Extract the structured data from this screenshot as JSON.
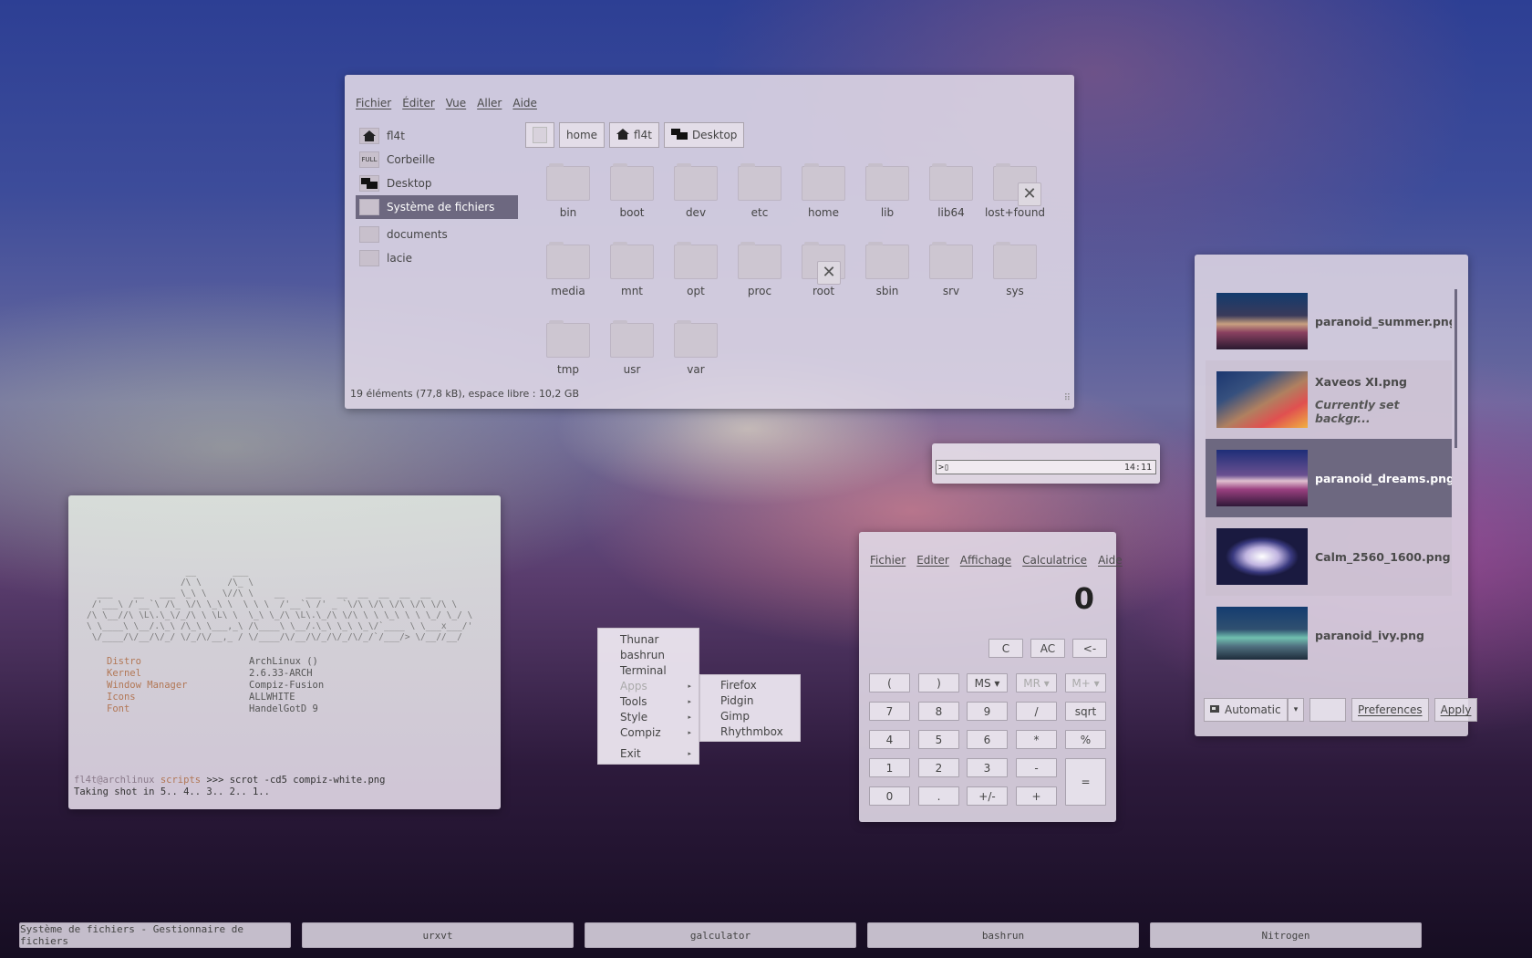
{
  "thunar": {
    "menu": [
      "Fichier",
      "Éditer",
      "Vue",
      "Aller",
      "Aide"
    ],
    "sidebar": [
      {
        "label": "fl4t",
        "icon": "home-icon"
      },
      {
        "label": "Corbeille",
        "icon": "trash-full-icon"
      },
      {
        "label": "Desktop",
        "icon": "desktop-icon"
      },
      {
        "label": "Système de fichiers",
        "icon": "drive-icon",
        "selected": true
      },
      {
        "label": "documents",
        "icon": "folder-icon"
      },
      {
        "label": "lacie",
        "icon": "folder-icon"
      }
    ],
    "trash_badge": "FULL",
    "path": [
      "home",
      "fl4t",
      "Desktop"
    ],
    "files": [
      "bin",
      "boot",
      "dev",
      "etc",
      "home",
      "lib",
      "lib64",
      "lost+found",
      "media",
      "mnt",
      "opt",
      "proc",
      "root",
      "sbin",
      "srv",
      "sys",
      "tmp",
      "usr",
      "var"
    ],
    "locked_glyph": "✕",
    "status": "19 éléments (77,8 kB), espace libre : 10,2 GB",
    "grip": "⠿"
  },
  "nitrogen": {
    "wallpapers": [
      {
        "name": "paranoid_summer.png",
        "sub": ""
      },
      {
        "name": "Xaveos XI.png",
        "sub": "Currently set backgr..."
      },
      {
        "name": "paranoid_dreams.png",
        "sub": "",
        "selected": true
      },
      {
        "name": "Calm_2560_1600.png",
        "sub": ""
      },
      {
        "name": "paranoid_ivy.png",
        "sub": ""
      }
    ],
    "mode": "Automatic",
    "preferences": "Preferences",
    "apply": "Apply",
    "dropdown_glyph": "▾"
  },
  "bashrun": {
    "prompt": ">▯",
    "clock": "14:11"
  },
  "terminal": {
    "ascii_art": "                   __       ___\n                  /\\ \\     /\\_ \\\n  ___    __   ___ \\_\\ \\   \\//\\ \\    __    ___   __  __  __  __  __\n /'___\\ /'__`\\ /\\_ \\/\\ \\_\\ \\  \\ \\ \\  /'__`\\ /' _ `\\/\\ \\/\\ \\/\\ \\/\\ \\/\\ \\\n/\\ \\__//\\ \\L\\.\\_\\/_/\\ \\ \\L\\ \\  \\_\\ \\_/\\ \\L\\.\\_/\\ \\/\\ \\ \\ \\_\\ \\ \\ \\_/ \\_/ \\\n\\ \\____\\ \\__/.\\_\\ /\\_\\ \\___,_\\ /\\____\\ \\__/.\\_\\ \\_\\ \\_\\/`____ \\ \\___x___/'\n \\/____/\\/__/\\/_/ \\/_/\\/__,_ / \\/____/\\/__/\\/_/\\/_/\\/_/`/___/> \\/__//__/",
    "info": [
      {
        "k": "Distro",
        "v": "ArchLinux  ()"
      },
      {
        "k": "Kernel",
        "v": "2.6.33-ARCH"
      },
      {
        "k": "Window Manager",
        "v": "Compiz-Fusion"
      },
      {
        "k": "Icons",
        "v": "ALLWHITE"
      },
      {
        "k": "Font",
        "v": "HandelGotD 9"
      }
    ],
    "user": "fl4t@archlinux",
    "dir": "scripts",
    "ps": ">>>",
    "command": "scrot -cd5 compiz-white.png",
    "output": "Taking shot in 5.. 4.. 3.. 2.. 1.."
  },
  "menu": {
    "items": [
      {
        "label": "Thunar",
        "sub": false,
        "disabled": false
      },
      {
        "label": "bashrun",
        "sub": false,
        "disabled": false
      },
      {
        "label": "Terminal",
        "sub": false,
        "disabled": false
      },
      {
        "label": "Apps",
        "sub": true,
        "disabled": true
      },
      {
        "label": "Tools",
        "sub": true,
        "disabled": false
      },
      {
        "label": "Style",
        "sub": true,
        "disabled": false
      },
      {
        "label": "Compiz",
        "sub": true,
        "disabled": false
      },
      {
        "label": "Exit",
        "sub": true,
        "disabled": false
      }
    ],
    "apps": [
      "Firefox",
      "Pidgin",
      "Gimp",
      "Rhythmbox"
    ],
    "arrow": "▸"
  },
  "calculator": {
    "menu": [
      "Fichier",
      "Editer",
      "Affichage",
      "Calculatrice",
      "Aide"
    ],
    "display": "0",
    "top_buttons": [
      "C",
      "AC",
      "<-"
    ],
    "buttons": [
      [
        "(",
        ")",
        "MS ▾",
        "MR ▾",
        "M+ ▾"
      ],
      [
        "7",
        "8",
        "9",
        "/",
        "sqrt"
      ],
      [
        "4",
        "5",
        "6",
        "*",
        "%"
      ],
      [
        "1",
        "2",
        "3",
        "-",
        "="
      ],
      [
        "0",
        ".",
        "+/-",
        "+"
      ]
    ]
  },
  "taskbar": [
    "Système de fichiers - Gestionnaire de fichiers",
    "urxvt",
    "galculator",
    "bashrun",
    "Nitrogen"
  ]
}
